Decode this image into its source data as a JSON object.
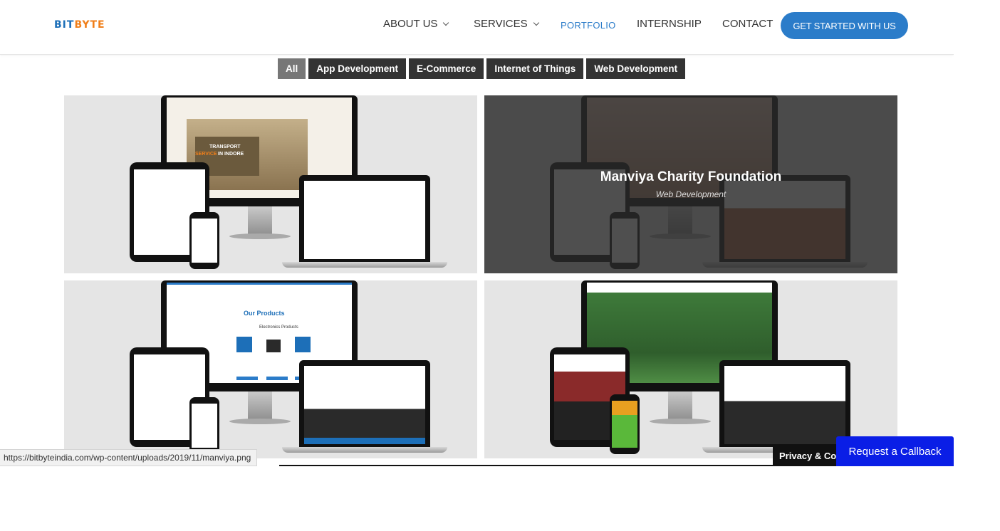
{
  "header": {
    "logo": {
      "part1": "BIT",
      "part2": "BYTE"
    },
    "nav": [
      {
        "label": "ABOUT US",
        "dropdown": true
      },
      {
        "label": "SERVICES",
        "dropdown": true
      },
      {
        "label": "PORTFOLIO",
        "active": true
      },
      {
        "label": "INTERNSHIP"
      },
      {
        "label": "CONTACT"
      }
    ],
    "cta_label": "GET STARTED WITH US"
  },
  "filters": [
    {
      "label": "All",
      "active": true
    },
    {
      "label": "App Development"
    },
    {
      "label": "E-Commerce"
    },
    {
      "label": "Internet of Things"
    },
    {
      "label": "Web Development"
    }
  ],
  "portfolio": {
    "hovered": {
      "title": "Manviya Charity Foundation",
      "category": "Web Development"
    },
    "item1_text": {
      "line1": "TRANSPORT",
      "line2": "SERVICE",
      "line3": "IN INDORE"
    },
    "item3_text": {
      "heading": "Our Products",
      "sub": "Electronics Products"
    }
  },
  "status_url": "https://bitbyteindia.com/wp-content/uploads/2019/11/manviya.png",
  "privacy_label": "Privacy & Cookies Policy",
  "callback_label": "Request a Callback",
  "colors": {
    "brand_blue": "#2b7cc9",
    "brand_orange": "#f07f1a",
    "callback_blue": "#0a1ee6"
  }
}
